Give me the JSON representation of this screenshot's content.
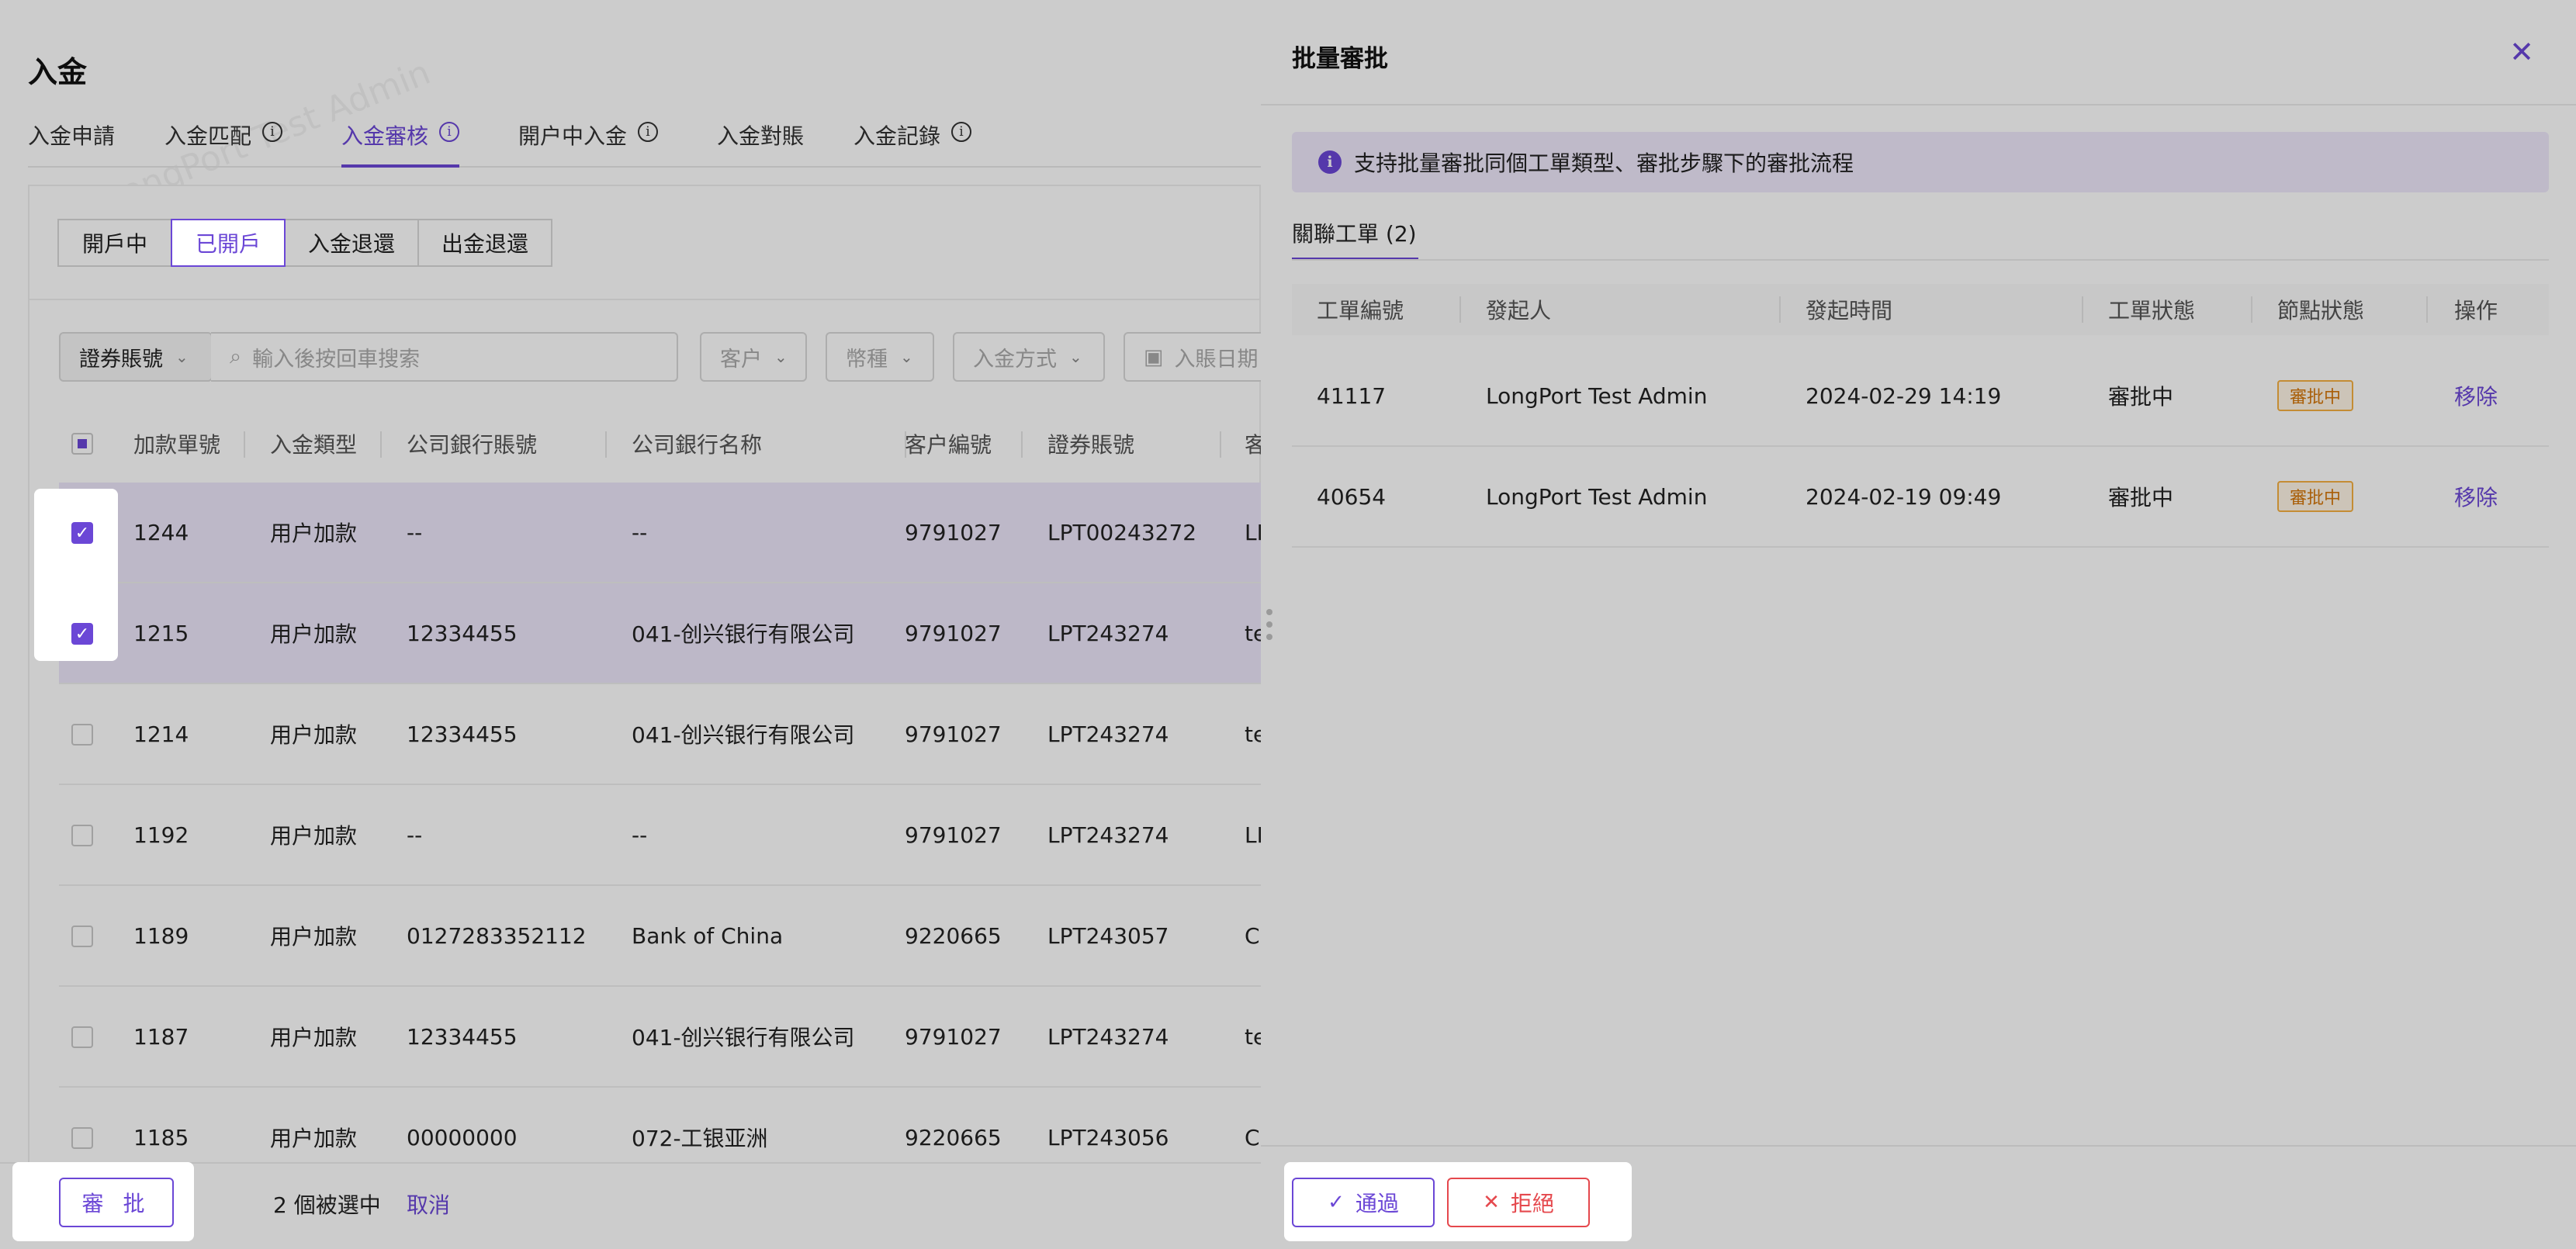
{
  "page": {
    "title": "入金",
    "tabs": [
      {
        "label": "入金申請",
        "info": false
      },
      {
        "label": "入金匹配",
        "info": true
      },
      {
        "label": "入金審核",
        "info": true,
        "active": true
      },
      {
        "label": "開户中入金",
        "info": true
      },
      {
        "label": "入金對賬",
        "info": false
      },
      {
        "label": "入金記錄",
        "info": true
      }
    ],
    "status_filters": [
      "開戶中",
      "已開戶",
      "入金退還",
      "出金退還"
    ],
    "active_status": "已開戶",
    "filters": {
      "account_type": "證券賬號",
      "search_placeholder": "輸入後按回車搜索",
      "customer": "客户",
      "currency": "幣種",
      "method": "入金方式",
      "date": "入賬日期"
    },
    "table": {
      "columns": [
        "加款單號",
        "入金類型",
        "公司銀行賬號",
        "公司銀行名称",
        "客户編號",
        "證券賬號",
        "客"
      ],
      "rows": [
        {
          "id": "1244",
          "type": "用户加款",
          "bank_acct": "--",
          "bank_name": "--",
          "cust": "9791027",
          "sec": "LPT00243272",
          "extra": "LI",
          "checked": true
        },
        {
          "id": "1215",
          "type": "用户加款",
          "bank_acct": "12334455",
          "bank_name": "041-创兴银行有限公司",
          "cust": "9791027",
          "sec": "LPT243274",
          "extra": "te",
          "checked": true
        },
        {
          "id": "1214",
          "type": "用户加款",
          "bank_acct": "12334455",
          "bank_name": "041-创兴银行有限公司",
          "cust": "9791027",
          "sec": "LPT243274",
          "extra": "te",
          "checked": false
        },
        {
          "id": "1192",
          "type": "用户加款",
          "bank_acct": "--",
          "bank_name": "--",
          "cust": "9791027",
          "sec": "LPT243274",
          "extra": "LI",
          "checked": false
        },
        {
          "id": "1189",
          "type": "用户加款",
          "bank_acct": "0127283352112",
          "bank_name": "Bank of China",
          "cust": "9220665",
          "sec": "LPT243057",
          "extra": "C",
          "checked": false
        },
        {
          "id": "1187",
          "type": "用户加款",
          "bank_acct": "12334455",
          "bank_name": "041-创兴银行有限公司",
          "cust": "9791027",
          "sec": "LPT243274",
          "extra": "te",
          "checked": false
        },
        {
          "id": "1185",
          "type": "用户加款",
          "bank_acct": "00000000",
          "bank_name": "072-工银亚洲",
          "cust": "9220665",
          "sec": "LPT243056",
          "extra": "C",
          "checked": false
        }
      ]
    },
    "footer": {
      "approve_label": "審 批",
      "selected_text": "2 個被選中",
      "cancel_label": "取消"
    },
    "watermark": "LongPort Test Admin"
  },
  "drawer": {
    "title": "批量審批",
    "alert": "支持批量審批同個工單類型、審批步驟下的審批流程",
    "tab_label": "關聯工單 (2)",
    "columns": [
      "工單編號",
      "發起人",
      "發起時間",
      "工單狀態",
      "節點狀態",
      "操作"
    ],
    "rows": [
      {
        "id": "41117",
        "initiator": "LongPort Test Admin",
        "time": "2024-02-29 14:19",
        "status": "審批中",
        "node": "審批中",
        "action": "移除"
      },
      {
        "id": "40654",
        "initiator": "LongPort Test Admin",
        "time": "2024-02-19 09:49",
        "status": "審批中",
        "node": "審批中",
        "action": "移除"
      }
    ],
    "pass_label": "通過",
    "reject_label": "拒絕"
  },
  "colors": {
    "accent": "#6b47d6",
    "danger": "#e5484d",
    "warning": "#d4760a"
  }
}
